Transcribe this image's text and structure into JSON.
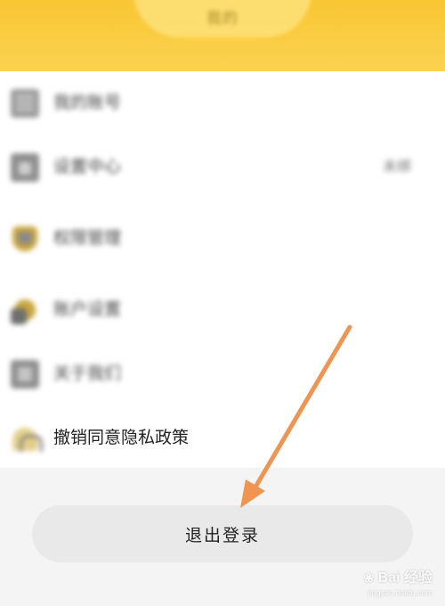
{
  "header": {
    "title": "我的"
  },
  "menu": {
    "items": [
      {
        "label": "我的账号",
        "value": "",
        "icon": "document-icon"
      },
      {
        "label": "设置中心",
        "value": "未绑",
        "icon": "lock-icon"
      },
      {
        "label": "权限管理",
        "value": "",
        "icon": "shield-icon"
      },
      {
        "label": "账户设置",
        "value": "",
        "icon": "gear-icon"
      },
      {
        "label": "关于我们",
        "value": "",
        "icon": "info-icon"
      },
      {
        "label": "撤销同意隐私政策",
        "value": "",
        "icon": "revoke-icon"
      }
    ]
  },
  "logout": {
    "label": "退出登录"
  },
  "annotation": {
    "arrow_color": "#f0944f"
  },
  "watermark": {
    "main": "Bai 经验",
    "sub": "jingyan.baidu.com"
  },
  "colors": {
    "header": "#f9c634",
    "card": "#ffffff",
    "background": "#f4f4f4",
    "button": "#e9e9e9"
  }
}
